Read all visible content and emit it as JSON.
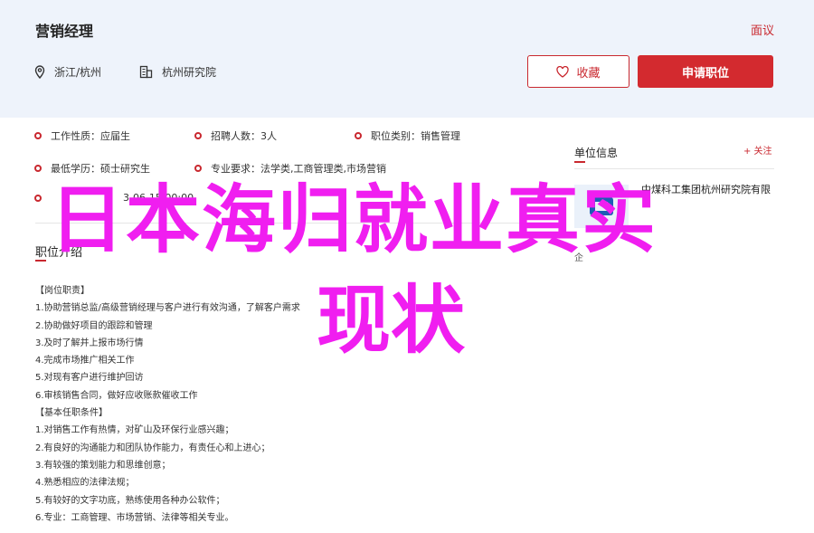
{
  "header": {
    "job_title": "营销经理",
    "report_label": "面议",
    "location": "浙江/杭州",
    "organization": "杭州研究院",
    "favorite_label": "收藏",
    "apply_label": "申请职位",
    "accent_color": "#d32a2f"
  },
  "info": {
    "row1": [
      {
        "key": "工作性质：",
        "value": "应届生"
      },
      {
        "key": "招聘人数：",
        "value": "3人"
      },
      {
        "key": "职位类别：",
        "value": "销售管理"
      }
    ],
    "row2": [
      {
        "key": "最低学历：",
        "value": "硕士研究生"
      },
      {
        "key": "专业要求：",
        "value": "法学类,工商管理类,市场营销"
      }
    ],
    "row3_partial": "3-06-15 00:00"
  },
  "section": {
    "title": "职位介绍"
  },
  "description": [
    "【岗位职责】",
    "1.协助营销总监/高级营销经理与客户进行有效沟通，了解客户需求",
    "2.协助做好项目的跟踪和管理",
    "3.及时了解并上报市场行情",
    "4.完成市场推广相关工作",
    "5.对现有客户进行维护回访",
    "6.审核销售合同，做好应收账款催收工作",
    "【基本任职条件】",
    "1.对销售工作有热情，对矿山及环保行业感兴趣；",
    "2.有良好的沟通能力和团队协作能力，有责任心和上进心；",
    "3.有较强的策划能力和思维创意；",
    "4.熟悉相应的法律法规；",
    "5.有较好的文字功底，熟练使用各种办公软件；",
    "6.专业：工商管理、市场营销、法律等相关专业。"
  ],
  "sidebar": {
    "title": "单位信息",
    "follow_label": "+ 关注",
    "company_name": "中煤科工集团杭州研究院有限",
    "small_text": "企"
  },
  "overlay": {
    "line1": "日本海归就业真实",
    "line2": "现状"
  },
  "icons": {
    "location": "map-pin-icon",
    "organization": "building-icon",
    "favorite": "heart-icon",
    "logo": "company-logo-icon"
  }
}
